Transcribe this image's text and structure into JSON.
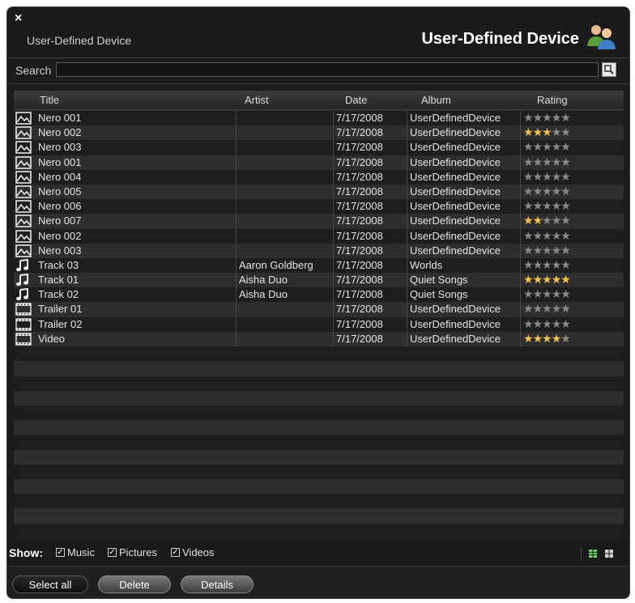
{
  "window": {
    "close_glyph": "×",
    "subtitle": "User-Defined Device",
    "title": "User-Defined Device"
  },
  "search": {
    "label": "Search",
    "value": "",
    "placeholder": ""
  },
  "columns": [
    "Title",
    "Artist",
    "Date",
    "Album",
    "Rating"
  ],
  "rows": [
    {
      "type": "picture",
      "title": "Nero 001",
      "artist": "",
      "date": "7/17/2008",
      "album": "UserDefinedDevice",
      "rating": 0
    },
    {
      "type": "picture",
      "title": "Nero 002",
      "artist": "",
      "date": "7/17/2008",
      "album": "UserDefinedDevice",
      "rating": 3
    },
    {
      "type": "picture",
      "title": "Nero 003",
      "artist": "",
      "date": "7/17/2008",
      "album": "UserDefinedDevice",
      "rating": 0
    },
    {
      "type": "picture",
      "title": "Nero 001",
      "artist": "",
      "date": "7/17/2008",
      "album": "UserDefinedDevice",
      "rating": 0
    },
    {
      "type": "picture",
      "title": "Nero 004",
      "artist": "",
      "date": "7/17/2008",
      "album": "UserDefinedDevice",
      "rating": 0
    },
    {
      "type": "picture",
      "title": "Nero 005",
      "artist": "",
      "date": "7/17/2008",
      "album": "UserDefinedDevice",
      "rating": 0
    },
    {
      "type": "picture",
      "title": "Nero 006",
      "artist": "",
      "date": "7/17/2008",
      "album": "UserDefinedDevice",
      "rating": 0
    },
    {
      "type": "picture",
      "title": "Nero 007",
      "artist": "",
      "date": "7/17/2008",
      "album": "UserDefinedDevice",
      "rating": 2
    },
    {
      "type": "picture",
      "title": "Nero 002",
      "artist": "",
      "date": "7/17/2008",
      "album": "UserDefinedDevice",
      "rating": 0
    },
    {
      "type": "picture",
      "title": "Nero 003",
      "artist": "",
      "date": "7/17/2008",
      "album": "UserDefinedDevice",
      "rating": 0
    },
    {
      "type": "music",
      "title": "Track 03",
      "artist": "Aaron Goldberg",
      "date": "7/17/2008",
      "album": "Worlds",
      "rating": 0
    },
    {
      "type": "music",
      "title": "Track 01",
      "artist": "Aisha Duo",
      "date": "7/17/2008",
      "album": "Quiet Songs",
      "rating": 5
    },
    {
      "type": "music",
      "title": "Track 02",
      "artist": "Aisha Duo",
      "date": "7/17/2008",
      "album": "Quiet Songs",
      "rating": 0
    },
    {
      "type": "video",
      "title": "Trailer 01",
      "artist": "",
      "date": "7/17/2008",
      "album": "UserDefinedDevice",
      "rating": 0
    },
    {
      "type": "video",
      "title": "Trailer 02",
      "artist": "",
      "date": "7/17/2008",
      "album": "UserDefinedDevice",
      "rating": 0
    },
    {
      "type": "video",
      "title": "Video",
      "artist": "",
      "date": "7/17/2008",
      "album": "UserDefinedDevice",
      "rating": 4
    }
  ],
  "show": {
    "label": "Show:",
    "filters": [
      {
        "label": "Music",
        "checked": true
      },
      {
        "label": "Pictures",
        "checked": true
      },
      {
        "label": "Videos",
        "checked": true
      }
    ]
  },
  "actions": {
    "select_all": "Select all",
    "delete": "Delete",
    "details": "Details"
  },
  "colors": {
    "star_on": "#f2c24a",
    "star_off": "#8a8a8a",
    "view_active": "#6fd36f"
  },
  "icons": {
    "picture": "picture-icon",
    "music": "music-note-icon",
    "video": "video-icon",
    "users": "users-icon",
    "search": "search-icon"
  }
}
